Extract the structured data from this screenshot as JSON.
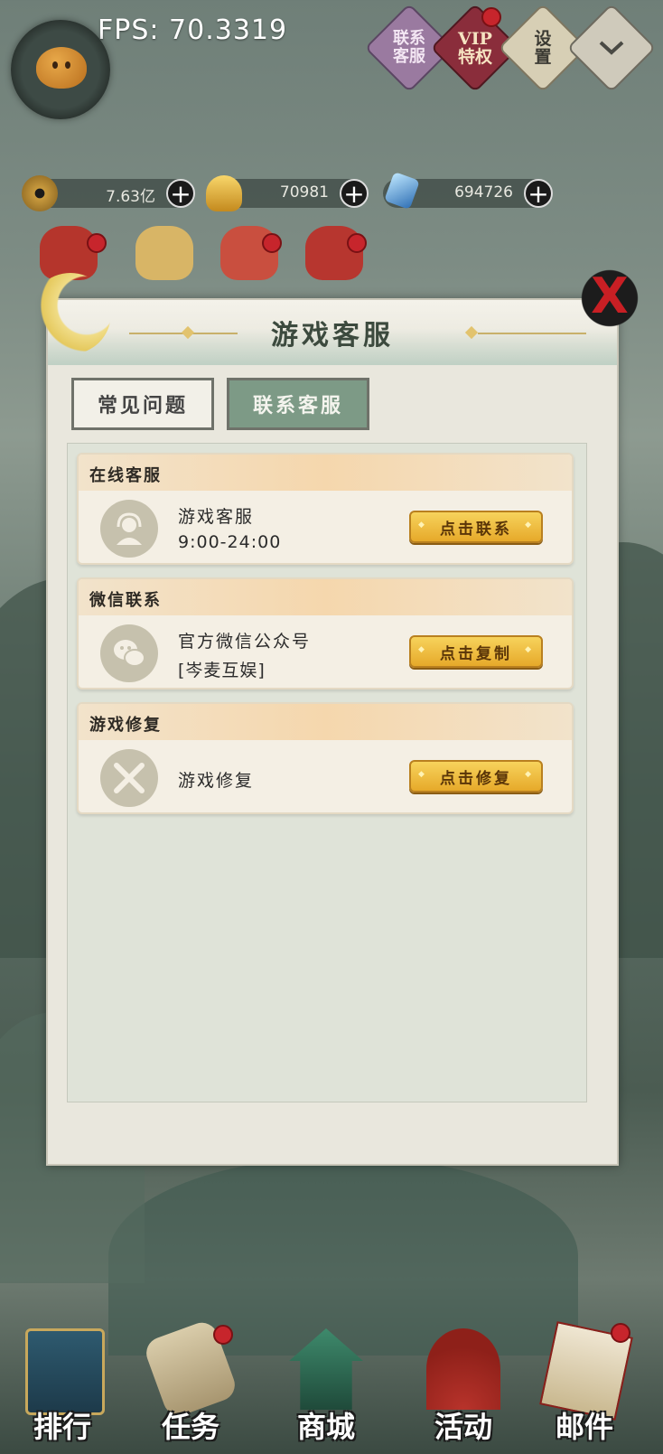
{
  "hud": {
    "fps": "FPS: 70.3319",
    "top_buttons": [
      {
        "label": "联系\n客服",
        "icon": "customer-service-icon"
      },
      {
        "label": "VIP\n特权",
        "icon": "vip-icon"
      },
      {
        "label": "设\n置",
        "icon": "settings-icon"
      },
      {
        "label": "",
        "icon": "collapse-chevron-icon"
      }
    ],
    "currencies": [
      {
        "value": "7.63亿",
        "icon": "copper-coin-icon"
      },
      {
        "value": "70981",
        "icon": "gold-ingot-icon"
      },
      {
        "value": "694726",
        "icon": "diamond-icon"
      }
    ],
    "plus_symbol": "+"
  },
  "dialog": {
    "title": "游戏客服",
    "close_symbol": "X",
    "tabs": [
      {
        "label": "常见问题",
        "active": false
      },
      {
        "label": "联系客服",
        "active": true
      }
    ],
    "cards": [
      {
        "title": "在线客服",
        "line1": "游戏客服",
        "line2": "9:00-24:00",
        "button": "点击联系",
        "icon": "headset-agent-icon"
      },
      {
        "title": "微信联系",
        "line1": "官方微信公众号",
        "line2": "[岑麦互娱]",
        "button": "点击复制",
        "icon": "wechat-icon"
      },
      {
        "title": "游戏修复",
        "line1": "游戏修复",
        "button": "点击修复",
        "icon": "repair-tools-icon"
      }
    ]
  },
  "bottom_nav": [
    {
      "label": "排行",
      "icon": "ranking-banner-icon"
    },
    {
      "label": "任务",
      "icon": "task-scroll-icon"
    },
    {
      "label": "商城",
      "icon": "shop-pavilion-icon"
    },
    {
      "label": "活动",
      "icon": "event-fan-icon"
    },
    {
      "label": "邮件",
      "icon": "mail-letter-icon"
    }
  ],
  "colors": {
    "accent_green": "#7d9a86",
    "button_gold": "#e6a92a",
    "notification_red": "#c7252c",
    "close_red": "#c81f24"
  }
}
